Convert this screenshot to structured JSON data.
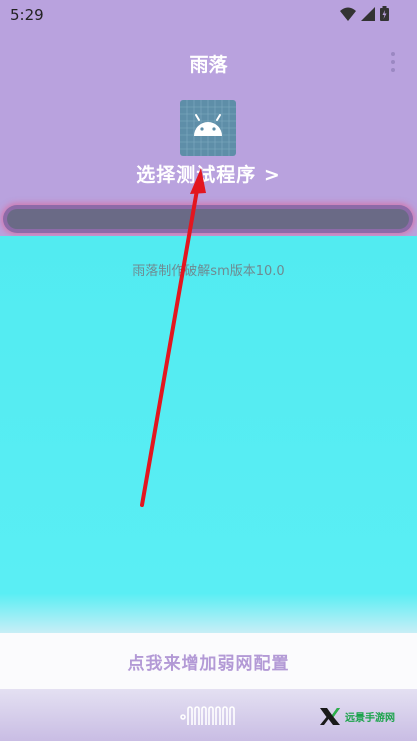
{
  "status_bar": {
    "time": "5:29"
  },
  "app_bar": {
    "title": "雨落"
  },
  "main": {
    "select_program_label": "选择测试程序 >"
  },
  "log": {
    "text": "雨落制作破解sm版本10.0"
  },
  "action": {
    "add_weak_network_label": "点我来增加弱网配置"
  },
  "watermark": {
    "text": "远景手游网"
  },
  "colors": {
    "header_bg": "#b9a2de",
    "panel_bg": "#55ecf2",
    "arrow": "#e3161f",
    "action_text": "#b39ad6"
  },
  "icons": [
    "wifi-icon",
    "signal-icon",
    "battery-icon",
    "more-icon",
    "android-icon",
    "arrow-annotation"
  ]
}
